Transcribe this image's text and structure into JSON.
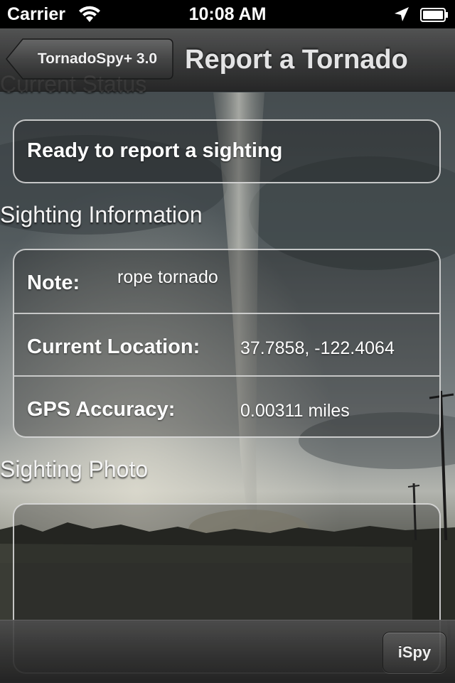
{
  "status_bar": {
    "carrier": "Carrier",
    "time": "10:08 AM"
  },
  "nav_bar": {
    "back_label": "TornadoSpy+ 3.0",
    "title": "Report a Tornado"
  },
  "sections": {
    "current_status": {
      "header": "Current Status",
      "status_text": "Ready to report a sighting"
    },
    "sighting_information": {
      "header": "Sighting Information",
      "rows": [
        {
          "key": "Note:",
          "value": "rope tornado"
        },
        {
          "key": "Current Location:",
          "value": "37.7858, -122.4064"
        },
        {
          "key": "GPS Accuracy:",
          "value": "0.00311 miles"
        }
      ]
    },
    "sighting_photo": {
      "header": "Sighting Photo"
    }
  },
  "toolbar": {
    "ispy_label": "iSpy"
  },
  "icons": {
    "wifi": "wifi-icon",
    "location": "location-arrow-icon",
    "battery": "battery-icon",
    "back": "back-chevron-icon"
  }
}
